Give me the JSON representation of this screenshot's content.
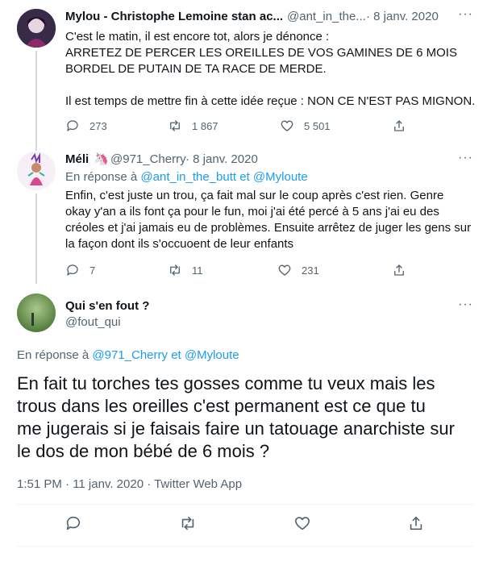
{
  "tweet1": {
    "name": "Mylou - Christophe Lemoine stan ac...",
    "handle": "@ant_in_the...",
    "date": "· 8 janv. 2020",
    "lines": [
      "C'est le matin, il est encore tot, alors je dénonce :",
      "ARRETEZ DE PERCER LES OREILLES DE VOS GAMINES DE 6 MOIS",
      "BORDEL DE PUTAIN DE TA RACE DE MERDE.",
      "",
      "Il est temps de mettre fin à cette idée reçue : NON CE N'EST PAS MIGNON."
    ],
    "replies": "273",
    "retweets": "1 867",
    "likes": "5 501"
  },
  "tweet2": {
    "name": "Méli",
    "handle": "@971_Cherry",
    "date": "· 8 janv. 2020",
    "reply_prefix": "En réponse à",
    "reply_to_1": "@ant_in_the_butt",
    "reply_and": "et",
    "reply_to_2": "@Myloute",
    "lines": [
      "Enfin, c'est juste un trou, ça fait mal sur le coup après c'est rien. Genre",
      "okay y'an a ils font ça pour le fun, moi j'ai été percé à 5 ans j'ai eu des",
      "créoles et j'ai jamais eu de problèmes. Ensuite arrêtez de juger les gens sur",
      "la façon dont ils s'occuoent de leur enfants"
    ],
    "replies": "7",
    "retweets": "11",
    "likes": "231"
  },
  "tweet3": {
    "name": "Qui s'en fout ?",
    "handle": "@fout_qui",
    "reply_prefix": "En réponse à",
    "reply_to_1": "@971_Cherry",
    "reply_and": "et",
    "reply_to_2": "@Myloute",
    "lines": [
      "En fait tu torches tes gosses comme tu veux mais les",
      "trous dans les oreilles c'est permanent est ce que tu",
      "me jugerais si je faisais faire un tatouage anarchiste sur",
      "le dos de mon bébé de 6 mois ?"
    ],
    "timestamp": "1:51 PM · 11 janv. 2020 · Twitter Web App"
  },
  "icons": {
    "reply": "reply-icon",
    "retweet": "retweet-icon",
    "like": "heart-icon",
    "share": "share-icon",
    "more": "more-icon",
    "badge": "unicorn-emoji-icon"
  },
  "colors": {
    "link": "#1d9bf0",
    "text": "#0f1419",
    "muted": "#536471",
    "line": "#cfd9de"
  }
}
